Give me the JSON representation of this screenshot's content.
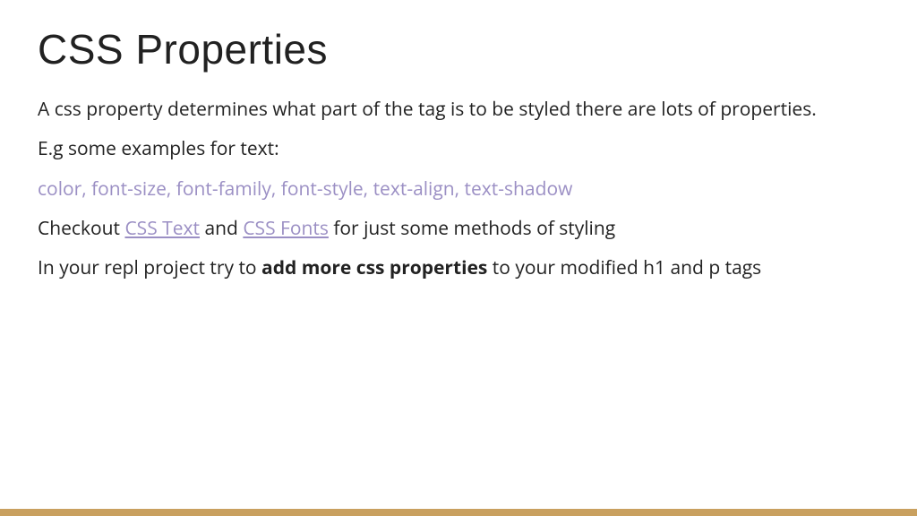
{
  "title": "CSS Properties",
  "para1": "A css property determines what part of the tag is to be styled there are lots of properties.",
  "para2": "E.g some examples for text:",
  "propertiesList": "color, font-size, font-family, font-style, text-align, text-shadow",
  "checkout": {
    "prefix": "Checkout ",
    "link1": "CSS Text",
    "middle": " and ",
    "link2": "CSS Fonts",
    "suffix": " for just some methods of styling"
  },
  "instruction": {
    "prefix": "In your repl project try to ",
    "bold": "add more css properties",
    "suffix": " to your modified h1 and p tags"
  }
}
